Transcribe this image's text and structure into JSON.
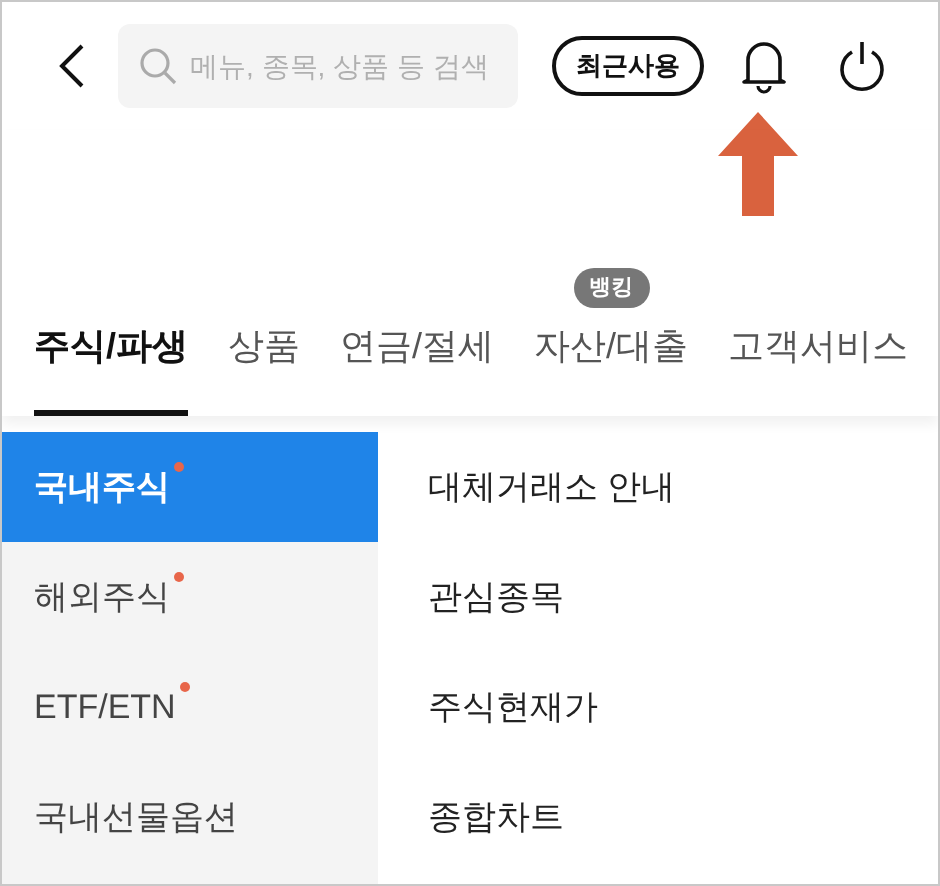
{
  "header": {
    "search": {
      "placeholder": "메뉴, 종목, 상품 등 검색"
    },
    "recent_button": "최근사용"
  },
  "tabs": [
    {
      "label": "주식/파생",
      "selected": true
    },
    {
      "label": "상품",
      "selected": false
    },
    {
      "label": "연금/절세",
      "selected": false
    },
    {
      "label": "자산/대출",
      "selected": false,
      "badge": "뱅킹"
    },
    {
      "label": "고객서비스",
      "selected": false
    }
  ],
  "sidebar": {
    "items": [
      {
        "label": "국내주식",
        "selected": true,
        "new": true
      },
      {
        "label": "해외주식",
        "selected": false,
        "new": true
      },
      {
        "label": "ETF/ETN",
        "selected": false,
        "new": true
      },
      {
        "label": "국내선물옵션",
        "selected": false,
        "new": false
      }
    ]
  },
  "menu": {
    "items": [
      "대체거래소 안내",
      "관심종목",
      "주식현재가",
      "종합차트"
    ]
  }
}
